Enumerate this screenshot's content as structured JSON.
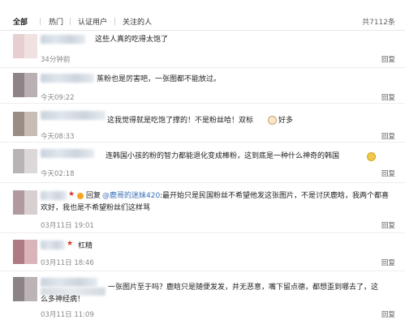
{
  "tabs": {
    "all": "全部",
    "hot": "热门",
    "verified": "认证用户",
    "following": "关注的人",
    "total": "共7112条"
  },
  "comments": [
    {
      "text": "这些人真的吃得太饱了",
      "time": "34分钟前",
      "reply": "回复"
    },
    {
      "text": "蒸粉也是厉害吧，一张图都不能放过。",
      "time": "今天09:22",
      "reply": "回复"
    },
    {
      "text": "这我觉得就是吃饱了撑的！不是粉丝哈！双标",
      "text_after": "好多",
      "time": "今天08:33",
      "reply": "回复"
    },
    {
      "text": "连韩国小孩的粉的智力都能退化变成棒粉，这到底是一种什么神奇的韩国",
      "time": "今天02:18",
      "reply": "回复"
    },
    {
      "prefix": "回复",
      "mention": "@鹿哥的迷妹420",
      "text": ":最开始只是民国粉丝不希望他发这张图片，不是讨厌鹿晗，我两个都喜",
      "text_line2": "欢好，我也是不希望粉丝们这样骂",
      "time": "03月11日 19:01",
      "reply": "回复"
    },
    {
      "text": "杠精",
      "time": "03月11日 18:46",
      "reply": "回复"
    },
    {
      "text": "一张图片至于吗？鹿晗只是随便发发，并无恶意，嘴下留点德，都想歪到哪去了，这",
      "text_line2": "么多神经病！",
      "time": "03月11日 11:09",
      "reply": "回复"
    }
  ],
  "colors": {
    "link": "#3a6fb5",
    "emoji_yellow": "#f2c84b",
    "star_red": "#d9342b"
  }
}
